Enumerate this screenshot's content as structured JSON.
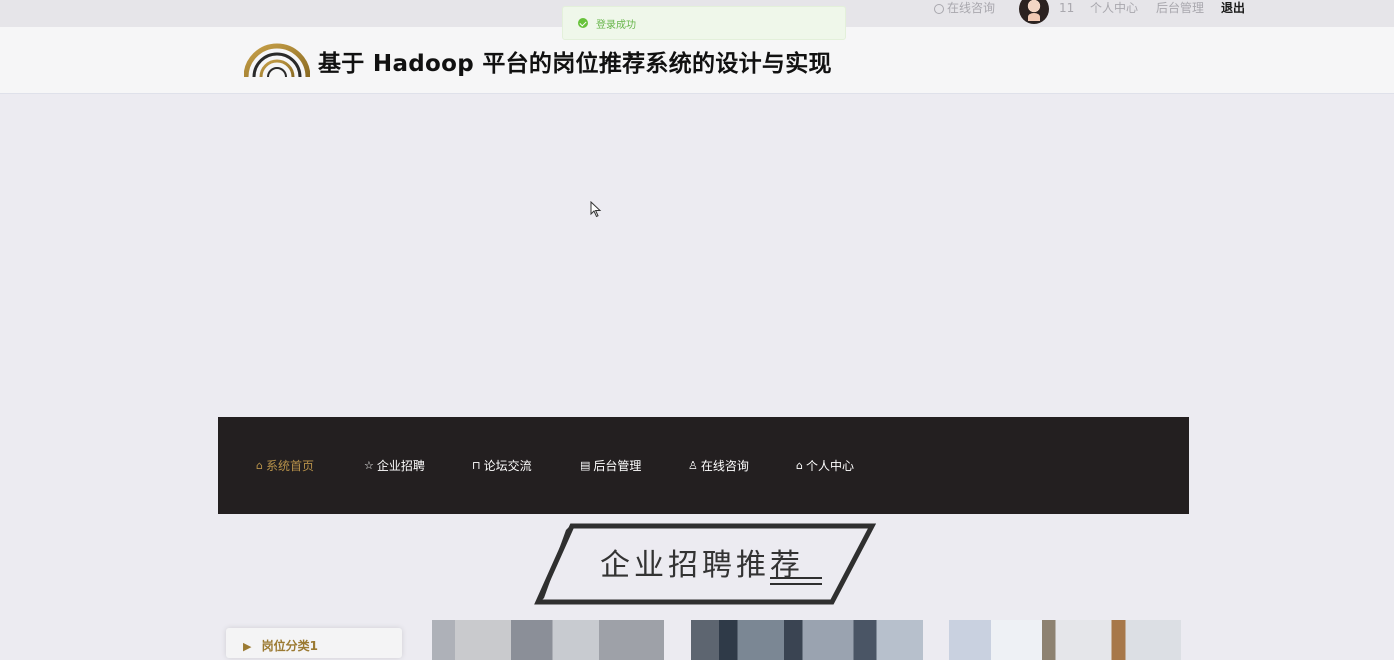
{
  "topbar": {
    "consult_label": "在线咨询",
    "username": "11",
    "personal_center": "个人中心",
    "backend": "后台管理",
    "logout": "退出"
  },
  "toast": {
    "message": "登录成功",
    "color": "#67c23a"
  },
  "header": {
    "title": "基于 Hadoop 平台的岗位推荐系统的设计与实现",
    "logo_icon": "arch-logo-icon"
  },
  "nav": {
    "items": [
      {
        "label": "系统首页",
        "icon": "home-icon",
        "active": true
      },
      {
        "label": "企业招聘",
        "icon": "star-icon",
        "active": false
      },
      {
        "label": "论坛交流",
        "icon": "bag-icon",
        "active": false
      },
      {
        "label": "后台管理",
        "icon": "document-icon",
        "active": false
      },
      {
        "label": "在线咨询",
        "icon": "user-icon",
        "active": false
      },
      {
        "label": "个人中心",
        "icon": "home-icon",
        "active": false
      }
    ],
    "active_color": "#b8924a",
    "background": "#231f20"
  },
  "section": {
    "title": "企业招聘推荐"
  },
  "category": {
    "label": "岗位分类1"
  }
}
